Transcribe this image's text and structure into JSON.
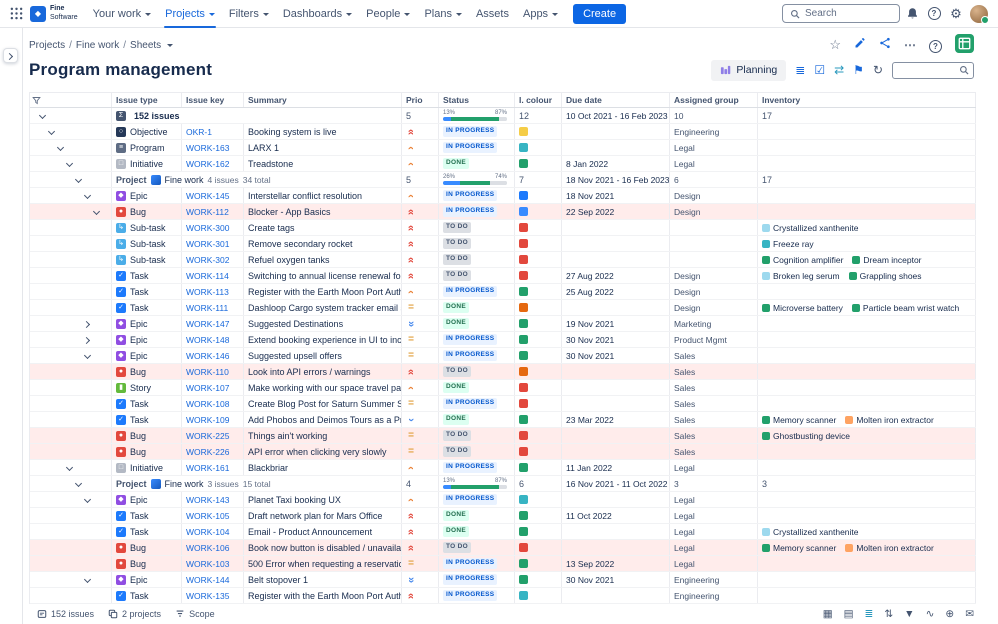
{
  "topnav": {
    "logo_line1": "Fine",
    "logo_line2": "Software",
    "items": [
      {
        "label": "Your work",
        "dropdown": true,
        "active": false
      },
      {
        "label": "Projects",
        "dropdown": true,
        "active": true
      },
      {
        "label": "Filters",
        "dropdown": true,
        "active": false
      },
      {
        "label": "Dashboards",
        "dropdown": true,
        "active": false
      },
      {
        "label": "People",
        "dropdown": true,
        "active": false
      },
      {
        "label": "Plans",
        "dropdown": true,
        "active": false
      },
      {
        "label": "Assets",
        "dropdown": false,
        "active": false
      },
      {
        "label": "Apps",
        "dropdown": true,
        "active": false
      }
    ],
    "create_label": "Create",
    "search_placeholder": "Search"
  },
  "breadcrumb": [
    "Projects",
    "Fine work",
    "Sheets"
  ],
  "page": {
    "title": "Program management",
    "icons": [
      "star",
      "edit",
      "share",
      "more",
      "help",
      "sheets"
    ]
  },
  "toolbar": {
    "planning_label": "Planning",
    "icons": [
      {
        "name": "rows-sort-icon",
        "glyph": "≣",
        "color": "#1868DB"
      },
      {
        "name": "checklist-icon",
        "glyph": "☑",
        "color": "#1868DB"
      },
      {
        "name": "swap-icon",
        "glyph": "⇄",
        "color": "#2898BD"
      },
      {
        "name": "flag-icon",
        "glyph": "⚑",
        "color": "#1868DB"
      },
      {
        "name": "refresh-icon",
        "glyph": "↻",
        "color": "#44546F"
      }
    ]
  },
  "colors": {
    "accent": "#0C66E4",
    "link": "#1868DB",
    "inprogress_bg": "#E9F2FF",
    "inprogress_text": "#0055CC",
    "done_bg": "#DCFFF1",
    "done_text": "#216E4E",
    "todo_bg": "#DCDFE4",
    "todo_text": "#44546F",
    "row_highlight": "#FFECEB"
  },
  "table": {
    "columns": [
      "Issue type",
      "Issue key",
      "Summary",
      "Prio",
      "Status",
      "I. colour",
      "Due date",
      "Assigned group",
      "Inventory"
    ],
    "rows": [
      {
        "kind": "total",
        "indent": 0,
        "chevron": "down",
        "icon": "Σ",
        "label": "152 issues",
        "prio": "5",
        "progress": {
          "left": "13%",
          "right": "87%",
          "seg": [
            [
              13,
              "#388BFF"
            ],
            [
              74,
              "#22A06B"
            ],
            [
              13,
              "#DCDFE4"
            ]
          ]
        },
        "colour": "12",
        "due": "10 Oct 2021 - 16 Feb 2023",
        "group": "10",
        "inv": "17"
      },
      {
        "kind": "issue",
        "indent": 1,
        "chevron": "down",
        "type": "Objective",
        "tc": "#253858",
        "tg": "○",
        "key": "OKR-1",
        "summary": "Booking system is live",
        "prio": "highest",
        "status": "IN PROGRESS",
        "sk": "inprogress",
        "colour": "#F5CD47",
        "due": "",
        "group": "Engineering",
        "inv": []
      },
      {
        "kind": "issue",
        "indent": 2,
        "chevron": "down",
        "type": "Program",
        "tc": "#5E6C84",
        "tg": "≡",
        "key": "WORK-163",
        "summary": "LARX 1",
        "prio": "high",
        "status": "IN PROGRESS",
        "sk": "inprogress",
        "colour": "#37B4C3",
        "due": "",
        "group": "Legal",
        "inv": []
      },
      {
        "kind": "issue",
        "indent": 3,
        "chevron": "down",
        "type": "Initiative",
        "tc": "#B3B9C4",
        "tg": "□",
        "key": "WORK-162",
        "summary": "Treadstone",
        "prio": "high",
        "status": "DONE",
        "sk": "done",
        "colour": "#22A06B",
        "due": "8 Jan 2022",
        "group": "Legal",
        "inv": []
      },
      {
        "kind": "project",
        "indent": 4,
        "chevron": "down",
        "label": "Project",
        "project": "Fine work",
        "issues": "4 issues",
        "total": "34 total",
        "prio": "5",
        "progress": {
          "left": "26%",
          "right": "74%",
          "seg": [
            [
              26,
              "#388BFF"
            ],
            [
              48,
              "#22A06B"
            ],
            [
              26,
              "#DCDFE4"
            ]
          ]
        },
        "colour": "7",
        "due": "18 Nov 2021 - 16 Feb 2023",
        "group": "6",
        "inv": "17"
      },
      {
        "kind": "issue",
        "indent": 5,
        "chevron": "down",
        "type": "Epic",
        "tc": "#904EE2",
        "tg": "◆",
        "key": "WORK-145",
        "summary": "Interstellar conflict resolution",
        "prio": "high",
        "status": "IN PROGRESS",
        "sk": "inprogress",
        "colour": "#1D7AFC",
        "due": "18 Nov 2021",
        "group": "Design",
        "inv": []
      },
      {
        "kind": "issue",
        "indent": 6,
        "chevron": "down",
        "type": "Bug",
        "tc": "#E2483D",
        "tg": "●",
        "key": "WORK-112",
        "summary": "Blocker - App Basics",
        "prio": "highest",
        "status": "IN PROGRESS",
        "sk": "inprogress",
        "colour": "#388BFF",
        "due": "22 Sep 2022",
        "group": "Design",
        "inv": [],
        "highlight": true
      },
      {
        "kind": "issue",
        "indent": 7,
        "chevron": null,
        "type": "Sub-task",
        "tc": "#4BADE8",
        "tg": "↳",
        "key": "WORK-300",
        "summary": "Create tags",
        "prio": "highest",
        "status": "TO DO",
        "sk": "todo",
        "colour": "#E2483D",
        "due": "",
        "group": "",
        "inv": [
          [
            "#9DD9EE",
            "Crystallized xanthenite"
          ]
        ]
      },
      {
        "kind": "issue",
        "indent": 7,
        "chevron": null,
        "type": "Sub-task",
        "tc": "#4BADE8",
        "tg": "↳",
        "key": "WORK-301",
        "summary": "Remove secondary rocket",
        "prio": "highest",
        "status": "TO DO",
        "sk": "todo",
        "colour": "#E2483D",
        "due": "",
        "group": "",
        "inv": [
          [
            "#37B4C3",
            "Freeze ray"
          ]
        ]
      },
      {
        "kind": "issue",
        "indent": 7,
        "chevron": null,
        "type": "Sub-task",
        "tc": "#4BADE8",
        "tg": "↳",
        "key": "WORK-302",
        "summary": "Refuel oxygen tanks",
        "prio": "highest",
        "status": "TO DO",
        "sk": "todo",
        "colour": "#E2483D",
        "due": "",
        "group": "",
        "inv": [
          [
            "#22A06B",
            "Cognition amplifier"
          ],
          [
            "#22A06B",
            "Dream inceptor"
          ]
        ]
      },
      {
        "kind": "issue",
        "indent": 6,
        "chevron": null,
        "type": "Task",
        "tc": "#1D7AFC",
        "tg": "✓",
        "key": "WORK-114",
        "summary": "Switching to annual license renewal for X...",
        "prio": "highest",
        "status": "TO DO",
        "sk": "todo",
        "colour": "#E2483D",
        "due": "27 Aug 2022",
        "group": "Design",
        "inv": [
          [
            "#9DD9EE",
            "Broken leg serum"
          ],
          [
            "#22A06B",
            "Grappling shoes"
          ]
        ]
      },
      {
        "kind": "issue",
        "indent": 6,
        "chevron": null,
        "type": "Task",
        "tc": "#1D7AFC",
        "tg": "✓",
        "key": "WORK-113",
        "summary": "Register with the Earth Moon Port Authority",
        "prio": "high",
        "status": "IN PROGRESS",
        "sk": "inprogress",
        "colour": "#22A06B",
        "due": "25 Aug 2022",
        "group": "Design",
        "inv": []
      },
      {
        "kind": "issue",
        "indent": 6,
        "chevron": null,
        "type": "Task",
        "tc": "#1D7AFC",
        "tg": "✓",
        "key": "WORK-111",
        "summary": "Dashloop Cargo system tracker email setup",
        "prio": "medium",
        "status": "DONE",
        "sk": "done",
        "colour": "#E56910",
        "due": "",
        "group": "Design",
        "inv": [
          [
            "#22A06B",
            "Microverse battery"
          ],
          [
            "#22A06B",
            "Particle beam wrist watch"
          ]
        ]
      },
      {
        "kind": "issue",
        "indent": 5,
        "chevron": "right",
        "type": "Epic",
        "tc": "#904EE2",
        "tg": "◆",
        "key": "WORK-147",
        "summary": "Suggested Destinations",
        "prio": "lowest",
        "status": "DONE",
        "sk": "done",
        "colour": "#22A06B",
        "due": "19 Nov 2021",
        "group": "Marketing",
        "inv": []
      },
      {
        "kind": "issue",
        "indent": 5,
        "chevron": "right",
        "type": "Epic",
        "tc": "#904EE2",
        "tg": "◆",
        "key": "WORK-148",
        "summary": "Extend booking experience in UI to include...",
        "prio": "medium",
        "status": "IN PROGRESS",
        "sk": "inprogress",
        "colour": "#22A06B",
        "due": "30 Nov 2021",
        "group": "Product Mgmt",
        "inv": []
      },
      {
        "kind": "issue",
        "indent": 5,
        "chevron": "down",
        "type": "Epic",
        "tc": "#904EE2",
        "tg": "◆",
        "key": "WORK-146",
        "summary": "Suggested upsell offers",
        "prio": "medium",
        "status": "IN PROGRESS",
        "sk": "inprogress",
        "colour": "#22A06B",
        "due": "30 Nov 2021",
        "group": "Sales",
        "inv": []
      },
      {
        "kind": "issue",
        "indent": 6,
        "chevron": null,
        "type": "Bug",
        "tc": "#E2483D",
        "tg": "●",
        "key": "WORK-110",
        "summary": "Look into API errors / warnings",
        "prio": "highest",
        "status": "TO DO",
        "sk": "todo",
        "colour": "#E56910",
        "due": "",
        "group": "Sales",
        "inv": [],
        "highlight": true
      },
      {
        "kind": "issue",
        "indent": 6,
        "chevron": null,
        "type": "Story",
        "tc": "#63BA3C",
        "tg": "▮",
        "key": "WORK-107",
        "summary": "Make working with our space travel partn...",
        "prio": "high",
        "status": "DONE",
        "sk": "done",
        "colour": "#E2483D",
        "due": "",
        "group": "Sales",
        "inv": []
      },
      {
        "kind": "issue",
        "indent": 6,
        "chevron": null,
        "type": "Task",
        "tc": "#1D7AFC",
        "tg": "✓",
        "key": "WORK-108",
        "summary": "Create Blog Post for Saturn Summer Sale",
        "prio": "medium",
        "status": "IN PROGRESS",
        "sk": "inprogress",
        "colour": "#E2483D",
        "due": "",
        "group": "Sales",
        "inv": []
      },
      {
        "kind": "issue",
        "indent": 6,
        "chevron": null,
        "type": "Task",
        "tc": "#1D7AFC",
        "tg": "✓",
        "key": "WORK-109",
        "summary": "Add Phobos and Deimos Tours as a Prefe...",
        "prio": "low",
        "status": "DONE",
        "sk": "done",
        "colour": "#22A06B",
        "due": "23 Mar 2022",
        "group": "Sales",
        "inv": [
          [
            "#22A06B",
            "Memory scanner"
          ],
          [
            "#FEA362",
            "Molten iron extractor"
          ]
        ]
      },
      {
        "kind": "issue",
        "indent": 6,
        "chevron": null,
        "type": "Bug",
        "tc": "#E2483D",
        "tg": "●",
        "key": "WORK-225",
        "summary": "Things ain't working",
        "prio": "medium",
        "status": "TO DO",
        "sk": "todo",
        "colour": "#E2483D",
        "due": "",
        "group": "Sales",
        "inv": [
          [
            "#22A06B",
            "Ghostbusting device"
          ]
        ],
        "highlight": true
      },
      {
        "kind": "issue",
        "indent": 6,
        "chevron": null,
        "type": "Bug",
        "tc": "#E2483D",
        "tg": "●",
        "key": "WORK-226",
        "summary": "API error when clicking very slowly",
        "prio": "medium",
        "status": "TO DO",
        "sk": "todo",
        "colour": "#E2483D",
        "due": "",
        "group": "Sales",
        "inv": [],
        "highlight": true
      },
      {
        "kind": "issue",
        "indent": 3,
        "chevron": "down",
        "type": "Initiative",
        "tc": "#B3B9C4",
        "tg": "□",
        "key": "WORK-161",
        "summary": "Blackbriar",
        "prio": "high",
        "status": "IN PROGRESS",
        "sk": "inprogress",
        "colour": "#22A06B",
        "due": "11 Jan 2022",
        "group": "Legal",
        "inv": []
      },
      {
        "kind": "project",
        "indent": 4,
        "chevron": "down",
        "label": "Project",
        "project": "Fine work",
        "issues": "3 issues",
        "total": "15 total",
        "prio": "4",
        "progress": {
          "left": "13%",
          "right": "87%",
          "seg": [
            [
              13,
              "#388BFF"
            ],
            [
              74,
              "#22A06B"
            ],
            [
              13,
              "#DCDFE4"
            ]
          ]
        },
        "colour": "6",
        "due": "16 Nov 2021 - 11 Oct 2022",
        "group": "3",
        "inv": "3"
      },
      {
        "kind": "issue",
        "indent": 5,
        "chevron": "down",
        "type": "Epic",
        "tc": "#904EE2",
        "tg": "◆",
        "key": "WORK-143",
        "summary": "Planet Taxi booking UX",
        "prio": "high",
        "status": "IN PROGRESS",
        "sk": "inprogress",
        "colour": "#37B4C3",
        "due": "",
        "group": "Legal",
        "inv": []
      },
      {
        "kind": "issue",
        "indent": 6,
        "chevron": null,
        "type": "Task",
        "tc": "#1D7AFC",
        "tg": "✓",
        "key": "WORK-105",
        "summary": "Draft network plan for Mars Office",
        "prio": "highest",
        "status": "DONE",
        "sk": "done",
        "colour": "#22A06B",
        "due": "11 Oct 2022",
        "group": "Legal",
        "inv": []
      },
      {
        "kind": "issue",
        "indent": 6,
        "chevron": null,
        "type": "Task",
        "tc": "#1D7AFC",
        "tg": "✓",
        "key": "WORK-104",
        "summary": "Email - Product Announcement",
        "prio": "highest",
        "status": "DONE",
        "sk": "done",
        "colour": "#22A06B",
        "due": "",
        "group": "Legal",
        "inv": [
          [
            "#9DD9EE",
            "Crystallized xanthenite"
          ]
        ]
      },
      {
        "kind": "issue",
        "indent": 6,
        "chevron": null,
        "type": "Bug",
        "tc": "#E2483D",
        "tg": "●",
        "key": "WORK-106",
        "summary": "Book now button is disabled / unavailable",
        "prio": "highest",
        "status": "TO DO",
        "sk": "todo",
        "colour": "#E2483D",
        "due": "",
        "group": "Legal",
        "inv": [
          [
            "#22A06B",
            "Memory scanner"
          ],
          [
            "#FEA362",
            "Molten iron extractor"
          ]
        ],
        "highlight": true
      },
      {
        "kind": "issue",
        "indent": 6,
        "chevron": null,
        "type": "Bug",
        "tc": "#E2483D",
        "tg": "●",
        "key": "WORK-103",
        "summary": "500 Error when requesting a reservation",
        "prio": "medium",
        "status": "IN PROGRESS",
        "sk": "inprogress",
        "colour": "#22A06B",
        "due": "13 Sep 2022",
        "group": "Legal",
        "inv": [],
        "highlight": true
      },
      {
        "kind": "issue",
        "indent": 5,
        "chevron": "down",
        "type": "Epic",
        "tc": "#904EE2",
        "tg": "◆",
        "key": "WORK-144",
        "summary": "Belt stopover 1",
        "prio": "lowest",
        "status": "IN PROGRESS",
        "sk": "inprogress",
        "colour": "#22A06B",
        "due": "30 Nov 2021",
        "group": "Engineering",
        "inv": []
      },
      {
        "kind": "issue",
        "indent": 6,
        "chevron": null,
        "type": "Task",
        "tc": "#1D7AFC",
        "tg": "✓",
        "key": "WORK-135",
        "summary": "Register with the Earth Moon Port Authority",
        "prio": "highest",
        "status": "IN PROGRESS",
        "sk": "inprogress",
        "colour": "#37B4C3",
        "due": "",
        "group": "Engineering",
        "inv": []
      }
    ]
  },
  "statusbar": {
    "issues": "152 issues",
    "projects": "2 projects",
    "scope": "Scope",
    "icons": [
      {
        "name": "table-view-icon",
        "glyph": "▦",
        "color": "#44546F"
      },
      {
        "name": "board-view-icon",
        "glyph": "▤",
        "color": "#44546F"
      },
      {
        "name": "timeline-view-icon",
        "glyph": "≣",
        "color": "#2898BD"
      },
      {
        "name": "sort-icon",
        "glyph": "⇅",
        "color": "#44546F"
      },
      {
        "name": "filter-icon",
        "glyph": "▼",
        "color": "#44546F"
      },
      {
        "name": "wave-chart-icon",
        "glyph": "∿",
        "color": "#44546F"
      },
      {
        "name": "add-circle-icon",
        "glyph": "⊕",
        "color": "#44546F"
      },
      {
        "name": "mail-icon",
        "glyph": "✉",
        "color": "#44546F"
      }
    ]
  }
}
